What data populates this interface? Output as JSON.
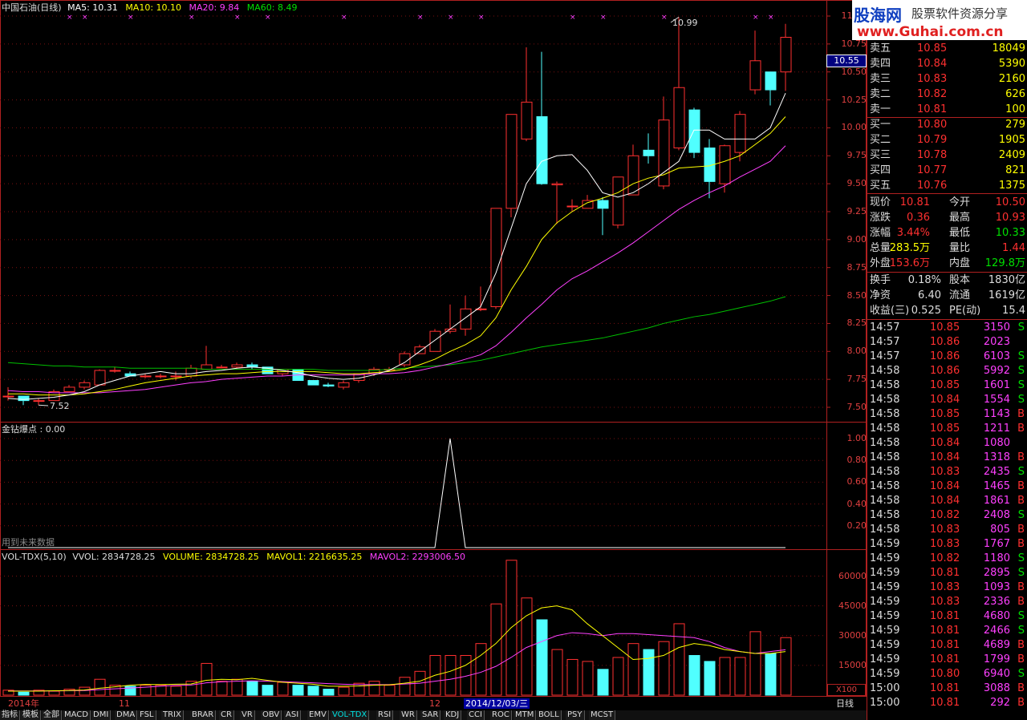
{
  "main_header": {
    "name": "中国石油(日线)",
    "ma5": "MA5: 10.31",
    "ma10": "MA10: 10.10",
    "ma20": "MA20: 9.84",
    "ma60": "MA60: 8.49"
  },
  "price_axis": [
    "11.00",
    "10.75",
    "10.50",
    "10.25",
    "10.00",
    "9.75",
    "9.50",
    "9.25",
    "9.00",
    "8.75",
    "8.50",
    "8.25",
    "8.00",
    "7.75",
    "7.50"
  ],
  "current_price_tag": "10.55",
  "high_label": "10.99",
  "low_label": "7.52",
  "indicator": {
    "title": "金钻爆点 : 0.00",
    "note": "用到未来数据",
    "axis": [
      "1.00",
      "0.80",
      "0.60",
      "0.40",
      "0.20"
    ]
  },
  "volume": {
    "label": "VOL-TDX(5,10)",
    "vvol": "VVOL: 2834728.25",
    "volume": "VOLUME: 2834728.25",
    "mavol1": "MAVOL1: 2216635.25",
    "mavol2": "MAVOL2: 2293006.50",
    "axis": [
      "60000",
      "45000",
      "30000",
      "15000"
    ],
    "unit": "X100"
  },
  "x_axis": {
    "year": "2014年",
    "m11": "11",
    "m12": "12",
    "cursor_date": "2014/12/03/三",
    "period": "日线"
  },
  "tabs": [
    "指标",
    "模板",
    "全部",
    "MACD",
    "DMI",
    "DMA",
    "FSL",
    "TRIX",
    "BRAR",
    "CR",
    "VR",
    "OBV",
    "ASI",
    "EMV",
    "VOL-TDX",
    "RSI",
    "WR",
    "SAR",
    "KDJ",
    "CCI",
    "ROC",
    "MTM",
    "BOLL",
    "PSY",
    "MCST"
  ],
  "logo": {
    "title": "股海网",
    "slogan": "股票软件资源分享",
    "url": "www.Guhai.com.cn"
  },
  "order_book": {
    "sell": [
      {
        "label": "卖五",
        "price": "10.85",
        "vol": "18049"
      },
      {
        "label": "卖四",
        "price": "10.84",
        "vol": "5390"
      },
      {
        "label": "卖三",
        "price": "10.83",
        "vol": "2160"
      },
      {
        "label": "卖二",
        "price": "10.82",
        "vol": "626"
      },
      {
        "label": "卖一",
        "price": "10.81",
        "vol": "100"
      }
    ],
    "buy": [
      {
        "label": "买一",
        "price": "10.80",
        "vol": "279"
      },
      {
        "label": "买二",
        "price": "10.79",
        "vol": "1905"
      },
      {
        "label": "买三",
        "price": "10.78",
        "vol": "2409"
      },
      {
        "label": "买四",
        "price": "10.77",
        "vol": "821"
      },
      {
        "label": "买五",
        "price": "10.76",
        "vol": "1375"
      }
    ]
  },
  "quote": [
    {
      "l1": "现价",
      "v1": "10.81",
      "l2": "今开",
      "v2": "10.50"
    },
    {
      "l1": "涨跌",
      "v1": "0.36",
      "l2": "最高",
      "v2": "10.93"
    },
    {
      "l1": "涨幅",
      "v1": "3.44%",
      "l2": "最低",
      "v2": "10.33"
    },
    {
      "l1": "总量",
      "v1": "283.5万",
      "l2": "量比",
      "v2": "1.44"
    },
    {
      "l1": "外盘",
      "v1": "153.6万",
      "l2": "内盘",
      "v2": "129.8万"
    }
  ],
  "fundamentals": [
    {
      "l1": "换手",
      "v1": "0.18%",
      "l2": "股本",
      "v2": "1830亿"
    },
    {
      "l1": "净资",
      "v1": "6.40",
      "l2": "流通",
      "v2": "1619亿"
    },
    {
      "l1": "收益(三)",
      "v1": "0.525",
      "l2": "PE(动)",
      "v2": "15.4"
    }
  ],
  "ticks": [
    {
      "t": "14:57",
      "p": "10.85",
      "v": "3150",
      "s": "S"
    },
    {
      "t": "14:57",
      "p": "10.86",
      "v": "2023",
      "s": ""
    },
    {
      "t": "14:57",
      "p": "10.86",
      "v": "6103",
      "s": "S"
    },
    {
      "t": "14:58",
      "p": "10.86",
      "v": "5992",
      "s": "S"
    },
    {
      "t": "14:58",
      "p": "10.85",
      "v": "1601",
      "s": "S"
    },
    {
      "t": "14:58",
      "p": "10.84",
      "v": "1554",
      "s": "S"
    },
    {
      "t": "14:58",
      "p": "10.85",
      "v": "1143",
      "s": "B"
    },
    {
      "t": "14:58",
      "p": "10.85",
      "v": "1211",
      "s": "B"
    },
    {
      "t": "14:58",
      "p": "10.84",
      "v": "1080",
      "s": ""
    },
    {
      "t": "14:58",
      "p": "10.84",
      "v": "1318",
      "s": "B"
    },
    {
      "t": "14:58",
      "p": "10.83",
      "v": "2435",
      "s": "S"
    },
    {
      "t": "14:58",
      "p": "10.84",
      "v": "1465",
      "s": "B"
    },
    {
      "t": "14:58",
      "p": "10.84",
      "v": "1861",
      "s": "B"
    },
    {
      "t": "14:58",
      "p": "10.82",
      "v": "2408",
      "s": "S"
    },
    {
      "t": "14:58",
      "p": "10.83",
      "v": "805",
      "s": "B"
    },
    {
      "t": "14:59",
      "p": "10.83",
      "v": "1767",
      "s": "B"
    },
    {
      "t": "14:59",
      "p": "10.82",
      "v": "1180",
      "s": "S"
    },
    {
      "t": "14:59",
      "p": "10.81",
      "v": "2895",
      "s": "S"
    },
    {
      "t": "14:59",
      "p": "10.83",
      "v": "1093",
      "s": "B"
    },
    {
      "t": "14:59",
      "p": "10.83",
      "v": "2336",
      "s": "B"
    },
    {
      "t": "14:59",
      "p": "10.81",
      "v": "4680",
      "s": "S"
    },
    {
      "t": "14:59",
      "p": "10.81",
      "v": "2466",
      "s": "S"
    },
    {
      "t": "14:59",
      "p": "10.81",
      "v": "4689",
      "s": "B"
    },
    {
      "t": "14:59",
      "p": "10.81",
      "v": "1799",
      "s": "B"
    },
    {
      "t": "14:59",
      "p": "10.80",
      "v": "6940",
      "s": "S"
    },
    {
      "t": "15:00",
      "p": "10.81",
      "v": "3088",
      "s": "B"
    },
    {
      "t": "15:00",
      "p": "10.81",
      "v": "292",
      "s": "B"
    }
  ],
  "chart_data": [
    {
      "type": "candlestick",
      "title": "中国石油(日线)",
      "ylim": [
        7.4,
        11.0
      ],
      "colors": {
        "up": "#ff3030",
        "down": "#50ffff",
        "ma5": "#ffffff",
        "ma10": "#ffff00",
        "ma20": "#ff40ff",
        "ma60": "#00c000"
      },
      "ohlc": [
        [
          7.6,
          7.68,
          7.56,
          7.6
        ],
        [
          7.6,
          7.6,
          7.52,
          7.56
        ],
        [
          7.56,
          7.58,
          7.52,
          7.56
        ],
        [
          7.56,
          7.66,
          7.56,
          7.64
        ],
        [
          7.64,
          7.7,
          7.64,
          7.68
        ],
        [
          7.68,
          7.74,
          7.66,
          7.72
        ],
        [
          7.7,
          7.84,
          7.7,
          7.83
        ],
        [
          7.83,
          7.86,
          7.81,
          7.83
        ],
        [
          7.8,
          7.82,
          7.78,
          7.78
        ],
        [
          7.78,
          7.8,
          7.76,
          7.78
        ],
        [
          7.78,
          7.8,
          7.76,
          7.78
        ],
        [
          7.78,
          7.82,
          7.74,
          7.78
        ],
        [
          7.78,
          7.88,
          7.76,
          7.85
        ],
        [
          7.84,
          8.05,
          7.84,
          7.88
        ],
        [
          7.86,
          7.88,
          7.85,
          7.86
        ],
        [
          7.86,
          7.9,
          7.84,
          7.88
        ],
        [
          7.88,
          7.9,
          7.84,
          7.86
        ],
        [
          7.86,
          7.86,
          7.8,
          7.8
        ],
        [
          7.8,
          7.84,
          7.78,
          7.84
        ],
        [
          7.84,
          7.84,
          7.74,
          7.74
        ],
        [
          7.74,
          7.74,
          7.7,
          7.7
        ],
        [
          7.7,
          7.72,
          7.68,
          7.69
        ],
        [
          7.68,
          7.74,
          7.66,
          7.72
        ],
        [
          7.74,
          7.8,
          7.72,
          7.8
        ],
        [
          7.8,
          7.86,
          7.78,
          7.84
        ],
        [
          7.84,
          7.86,
          7.82,
          7.84
        ],
        [
          7.88,
          8.0,
          7.86,
          7.98
        ],
        [
          7.98,
          8.06,
          7.98,
          8.04
        ],
        [
          8.0,
          8.2,
          8.0,
          8.18
        ],
        [
          8.18,
          8.42,
          8.16,
          8.2
        ],
        [
          8.2,
          8.5,
          8.14,
          8.38
        ],
        [
          8.38,
          8.58,
          8.36,
          8.38
        ],
        [
          8.4,
          9.28,
          8.38,
          9.28
        ],
        [
          9.28,
          10.12,
          9.2,
          10.12
        ],
        [
          9.9,
          10.72,
          9.88,
          10.23
        ],
        [
          10.1,
          10.68,
          9.49,
          9.5
        ],
        [
          9.49,
          9.52,
          9.14,
          9.5
        ],
        [
          9.3,
          9.36,
          9.25,
          9.3
        ],
        [
          9.28,
          9.4,
          9.28,
          9.35
        ],
        [
          9.35,
          9.38,
          9.04,
          9.28
        ],
        [
          9.13,
          9.56,
          9.1,
          9.56
        ],
        [
          9.4,
          9.85,
          9.4,
          9.75
        ],
        [
          9.8,
          9.95,
          9.68,
          9.75
        ],
        [
          9.48,
          10.28,
          9.45,
          10.07
        ],
        [
          9.82,
          10.99,
          9.8,
          10.36
        ],
        [
          10.16,
          10.18,
          9.73,
          9.78
        ],
        [
          9.82,
          9.9,
          9.37,
          9.52
        ],
        [
          9.5,
          9.85,
          9.42,
          9.84
        ],
        [
          9.78,
          10.15,
          9.7,
          10.12
        ],
        [
          10.34,
          10.87,
          10.3,
          10.6
        ],
        [
          10.5,
          10.5,
          10.2,
          10.34
        ],
        [
          10.5,
          10.93,
          10.33,
          10.81
        ]
      ],
      "ma5": [
        7.58,
        7.57,
        7.58,
        7.59,
        7.61,
        7.64,
        7.7,
        7.74,
        7.78,
        7.8,
        7.82,
        7.8,
        7.8,
        7.82,
        7.83,
        7.85,
        7.86,
        7.85,
        7.83,
        7.81,
        7.78,
        7.76,
        7.75,
        7.76,
        7.79,
        7.83,
        7.9,
        8.0,
        8.1,
        8.2,
        8.3,
        8.4,
        8.7,
        9.1,
        9.5,
        9.7,
        9.75,
        9.76,
        9.62,
        9.42,
        9.38,
        9.42,
        9.5,
        9.6,
        9.7,
        9.98,
        9.98,
        9.9,
        9.9,
        9.9,
        10.0,
        10.31
      ],
      "ma10": [
        7.62,
        7.62,
        7.61,
        7.61,
        7.61,
        7.62,
        7.64,
        7.66,
        7.69,
        7.72,
        7.74,
        7.76,
        7.78,
        7.79,
        7.8,
        7.8,
        7.81,
        7.82,
        7.82,
        7.82,
        7.82,
        7.81,
        7.8,
        7.8,
        7.81,
        7.82,
        7.84,
        7.88,
        7.93,
        8.0,
        8.06,
        8.14,
        8.3,
        8.55,
        8.76,
        9.0,
        9.15,
        9.25,
        9.33,
        9.37,
        9.42,
        9.5,
        9.55,
        9.58,
        9.64,
        9.65,
        9.66,
        9.7,
        9.75,
        9.85,
        9.95,
        10.1
      ],
      "ma20": [
        7.65,
        7.64,
        7.64,
        7.63,
        7.63,
        7.63,
        7.63,
        7.64,
        7.65,
        7.66,
        7.68,
        7.7,
        7.72,
        7.73,
        7.75,
        7.76,
        7.77,
        7.78,
        7.78,
        7.79,
        7.79,
        7.79,
        7.79,
        7.79,
        7.8,
        7.8,
        7.81,
        7.83,
        7.86,
        7.89,
        7.93,
        7.97,
        8.05,
        8.17,
        8.3,
        8.42,
        8.55,
        8.65,
        8.72,
        8.8,
        8.88,
        8.97,
        9.07,
        9.17,
        9.27,
        9.35,
        9.42,
        9.48,
        9.56,
        9.63,
        9.7,
        9.84
      ],
      "ma60": [
        7.9,
        7.89,
        7.88,
        7.87,
        7.87,
        7.86,
        7.86,
        7.86,
        7.85,
        7.85,
        7.85,
        7.85,
        7.85,
        7.84,
        7.84,
        7.84,
        7.84,
        7.84,
        7.84,
        7.84,
        7.84,
        7.83,
        7.83,
        7.83,
        7.83,
        7.84,
        7.85,
        7.86,
        7.87,
        7.88,
        7.9,
        7.92,
        7.95,
        7.98,
        8.01,
        8.04,
        8.06,
        8.08,
        8.1,
        8.12,
        8.15,
        8.18,
        8.21,
        8.25,
        8.28,
        8.31,
        8.33,
        8.36,
        8.39,
        8.42,
        8.45,
        8.49
      ]
    },
    {
      "type": "line",
      "title": "金钻爆点",
      "ylim": [
        0,
        1.0
      ],
      "values": [
        0,
        0,
        0,
        0,
        0,
        0,
        0,
        0,
        0,
        0,
        0,
        0,
        0,
        0,
        0,
        0,
        0,
        0,
        0,
        0,
        0,
        0,
        0,
        0,
        0,
        0,
        0,
        0,
        0,
        1,
        0,
        0,
        0,
        0,
        0,
        0,
        0,
        0,
        0,
        0,
        0,
        0,
        0,
        0,
        0,
        0,
        0,
        0,
        0,
        0,
        0,
        0
      ]
    },
    {
      "type": "bar",
      "title": "VOL-TDX(5,10)",
      "ylim": [
        0,
        67500
      ],
      "values": [
        2500,
        1500,
        2500,
        2000,
        3000,
        4000,
        8000,
        5000,
        4500,
        5000,
        5000,
        4500,
        7000,
        16000,
        7000,
        8000,
        7000,
        5000,
        6500,
        5000,
        4500,
        3000,
        4000,
        6000,
        7000,
        5000,
        9000,
        12000,
        20000,
        20000,
        20000,
        26000,
        46000,
        68000,
        49000,
        38000,
        23000,
        18000,
        17000,
        13000,
        19000,
        26000,
        23000,
        27000,
        36000,
        20000,
        17000,
        19000,
        19000,
        32000,
        21000,
        29000
      ],
      "mavol1": [
        2000,
        2000,
        2000,
        2200,
        2300,
        2600,
        3500,
        4200,
        5000,
        5400,
        5300,
        5500,
        5600,
        7500,
        8000,
        7800,
        8500,
        7500,
        6500,
        6000,
        5500,
        4500,
        4500,
        4600,
        5000,
        5200,
        6000,
        7000,
        10000,
        12000,
        15000,
        20000,
        26000,
        34000,
        40000,
        44000,
        45000,
        43000,
        36000,
        30000,
        24000,
        18000,
        18500,
        20000,
        24000,
        26000,
        25000,
        23000,
        22000,
        21000,
        21000,
        22000
      ],
      "mavol2": [
        2100,
        2100,
        2100,
        2100,
        2200,
        2300,
        2800,
        3200,
        3600,
        4000,
        4500,
        4900,
        5100,
        6200,
        6700,
        7000,
        7200,
        7000,
        6800,
        6500,
        6200,
        5800,
        5500,
        5300,
        5300,
        5300,
        5600,
        6000,
        7000,
        8000,
        9500,
        11500,
        14500,
        19000,
        24000,
        27000,
        30000,
        31500,
        31000,
        30000,
        31000,
        31000,
        30500,
        30000,
        29500,
        29000,
        27000,
        24000,
        22000,
        21000,
        22000,
        22900
      ]
    }
  ]
}
